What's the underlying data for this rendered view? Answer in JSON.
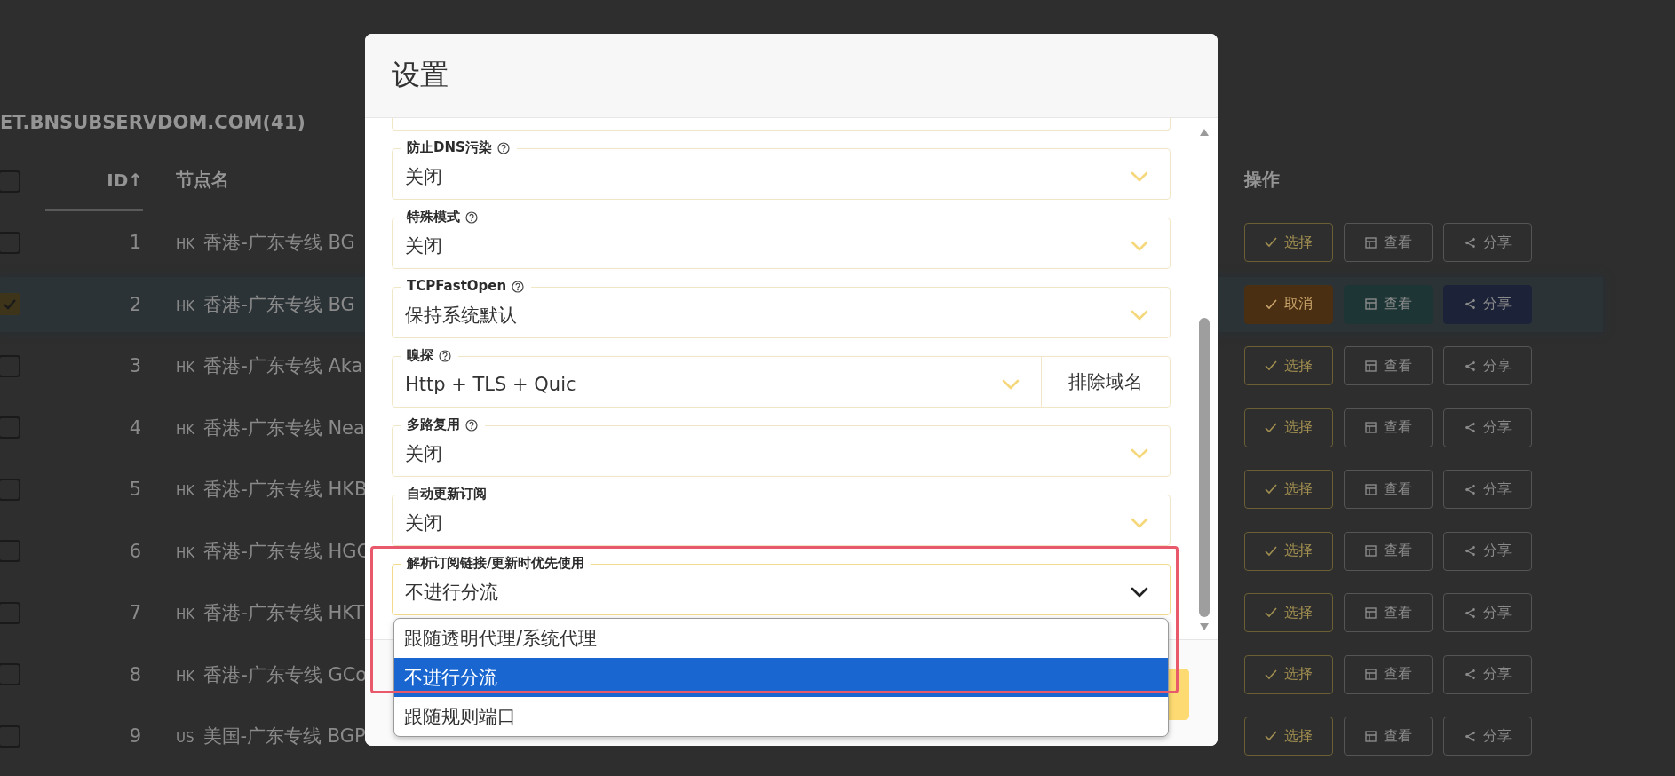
{
  "page": {
    "title": "ET.BNSUBSERVDOM.COM(41)",
    "all_selected": false,
    "columns": [
      {
        "label": "ID↑",
        "sorted": true
      },
      {
        "label": "节点名",
        "sorted": false
      },
      {
        "label": "操作",
        "sorted": false
      }
    ],
    "rows": [
      {
        "id": "1",
        "region": "HK",
        "name": "香港-广东专线 BG",
        "selected": false,
        "actions": [
          "选择",
          "查看",
          "分享"
        ]
      },
      {
        "id": "2",
        "region": "HK",
        "name": "香港-广东专线 BG",
        "selected": true,
        "actions": [
          "取消",
          "查看",
          "分享"
        ]
      },
      {
        "id": "3",
        "region": "HK",
        "name": "香港-广东专线 Aka",
        "selected": false,
        "actions": [
          "选择",
          "查看",
          "分享"
        ]
      },
      {
        "id": "4",
        "region": "HK",
        "name": "香港-广东专线 Nea",
        "selected": false,
        "actions": [
          "选择",
          "查看",
          "分享"
        ]
      },
      {
        "id": "5",
        "region": "HK",
        "name": "香港-广东专线 HKB",
        "selected": false,
        "actions": [
          "选择",
          "查看",
          "分享"
        ]
      },
      {
        "id": "6",
        "region": "HK",
        "name": "香港-广东专线 HGC",
        "selected": false,
        "actions": [
          "选择",
          "查看",
          "分享"
        ]
      },
      {
        "id": "7",
        "region": "HK",
        "name": "香港-广东专线 HKT",
        "selected": false,
        "actions": [
          "选择",
          "查看",
          "分享"
        ]
      },
      {
        "id": "8",
        "region": "HK",
        "name": "香港-广东专线 GCo",
        "selected": false,
        "actions": [
          "选择",
          "查看",
          "分享"
        ]
      },
      {
        "id": "9",
        "region": "US",
        "name": "美国-广东专线 BGP",
        "selected": false,
        "actions": [
          "选择",
          "查看",
          "分享"
        ]
      }
    ]
  },
  "dialog": {
    "title": "设置",
    "fields": [
      {
        "label": "防止DNS污染",
        "help": true,
        "value": "关闭",
        "expanded": false
      },
      {
        "label": "特殊模式",
        "help": true,
        "value": "关闭",
        "expanded": false
      },
      {
        "label": "TCPFastOpen",
        "help": true,
        "value": "保持系统默认",
        "expanded": false
      },
      {
        "label": "嗅探",
        "help": true,
        "value": "Http + TLS + Quic",
        "expanded": false,
        "button": "排除域名"
      },
      {
        "label": "多路复用",
        "help": true,
        "value": "关闭",
        "expanded": false
      },
      {
        "label": "自动更新订阅",
        "help": false,
        "value": "关闭",
        "expanded": false
      },
      {
        "label": "解析订阅链接/更新时优先使用",
        "help": false,
        "value": "不进行分流",
        "expanded": true,
        "options": [
          {
            "label": "跟随透明代理/系统代理",
            "selected": false
          },
          {
            "label": "不进行分流",
            "selected": true
          },
          {
            "label": "跟随规则端口",
            "selected": false
          }
        ]
      }
    ]
  }
}
